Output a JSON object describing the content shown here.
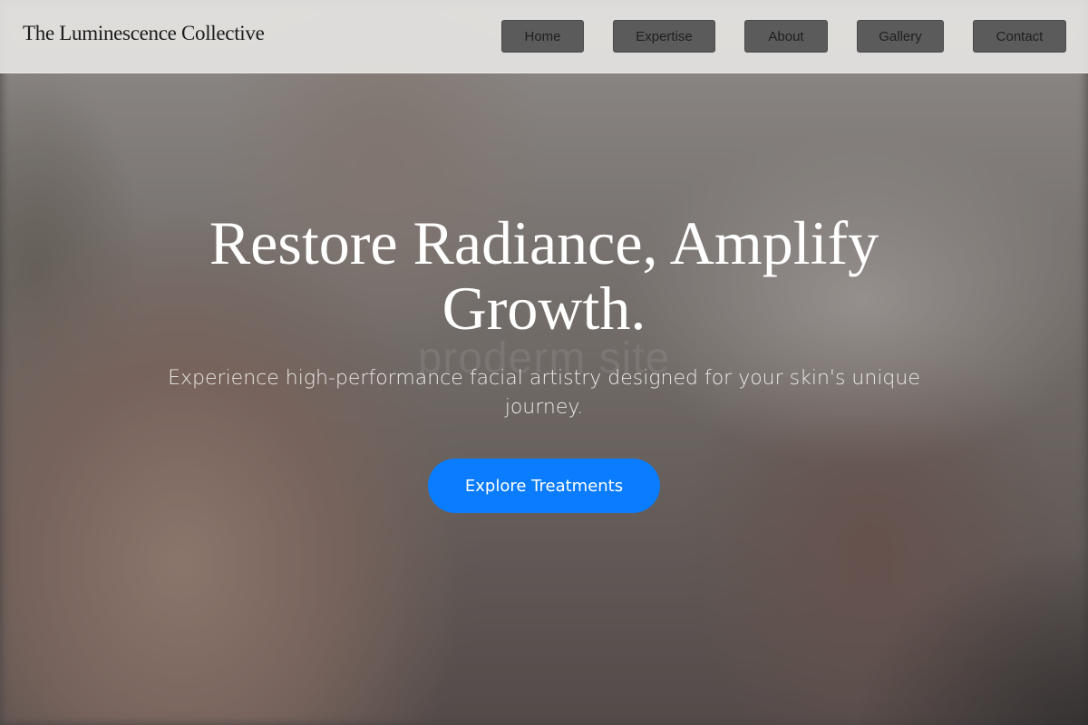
{
  "header": {
    "brand": "The Luminescence Collective",
    "nav": [
      {
        "label": "Home"
      },
      {
        "label": "Expertise"
      },
      {
        "label": "About"
      },
      {
        "label": "Gallery"
      },
      {
        "label": "Contact"
      }
    ]
  },
  "hero": {
    "title": "Restore Radiance, Amplify Growth.",
    "watermark": "proderm site",
    "subtitle": "Experience high-performance facial artistry designed for your skin's unique journey.",
    "cta_label": "Explore Treatments"
  },
  "colors": {
    "cta": "#0a7cff",
    "nav_button": "#5b5b5b",
    "header_bg": "#e4e3e1",
    "hero_text": "#ffffff"
  }
}
